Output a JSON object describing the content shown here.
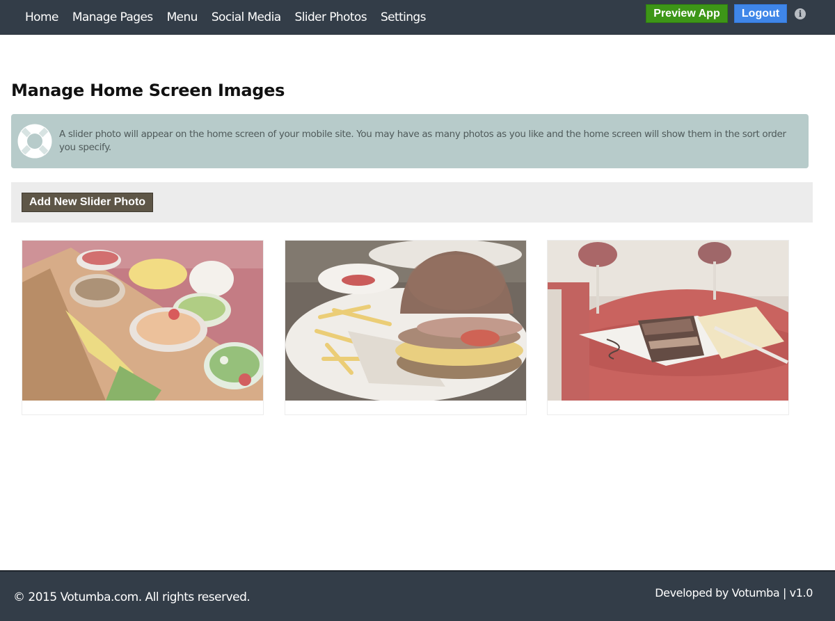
{
  "nav": {
    "items": [
      {
        "label": "Home"
      },
      {
        "label": "Manage Pages"
      },
      {
        "label": "Menu"
      },
      {
        "label": "Social Media"
      },
      {
        "label": "Slider Photos"
      },
      {
        "label": "Settings"
      }
    ],
    "preview_label": "Preview App",
    "logout_label": "Logout",
    "info_glyph": "i",
    "icon": "info-icon"
  },
  "page": {
    "title": "Manage Home Screen Images"
  },
  "alert": {
    "icon": "lifebuoy-icon",
    "text": "A slider photo will appear on the home screen of your mobile site. You may have as many photos as you like and the home screen will show them in the sort order you specify."
  },
  "toolbar": {
    "add_label": "Add New Slider Photo"
  },
  "photos": [
    {
      "subject": "salad buffet",
      "icon": "salad-photo"
    },
    {
      "subject": "burger with fries",
      "icon": "burger-photo"
    },
    {
      "subject": "chocolate cake with wine",
      "icon": "cake-photo"
    }
  ],
  "footer": {
    "copyright": "© 2015 Votumba.com. All rights reserved.",
    "developer": "Developed by Votumba | v1.0"
  },
  "colors": {
    "navbar": "#333d48",
    "preview_button": "#3d9617",
    "logout_button": "#3f86e8",
    "alert_bg": "#b7cbca",
    "toolbar_bg": "#ececec",
    "add_button": "#5e5647"
  }
}
